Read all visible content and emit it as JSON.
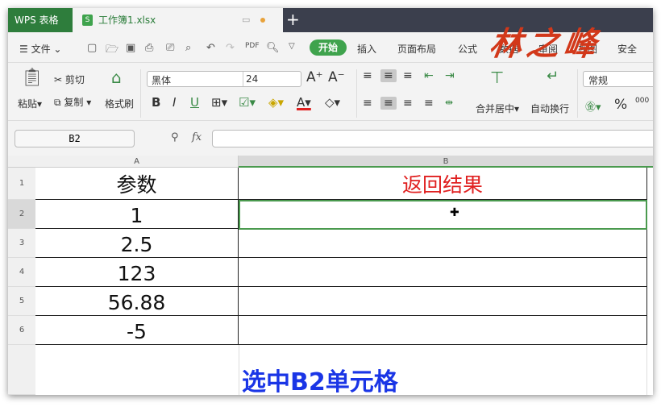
{
  "titlebar": {
    "app_tab": "WPS 表格",
    "doc_tab": "工作簿1.xlsx",
    "doc_icon": "S",
    "new_tab": "+"
  },
  "menu": {
    "file": "文件",
    "start": "开始",
    "tabs": [
      "插入",
      "页面布局",
      "公式",
      "数据",
      "审阅",
      "视图",
      "安全"
    ]
  },
  "watermark": "林之峰",
  "ribbon": {
    "paste": "粘贴",
    "cut": "剪切",
    "copy": "复制",
    "format_painter": "格式刷",
    "font": "黑体",
    "font_size": "24",
    "merge": "合并居中",
    "wrap": "自动换行",
    "number_format": "常规"
  },
  "formula_bar": {
    "name_box": "B2",
    "fx": "fx",
    "value": ""
  },
  "sheet": {
    "columns": [
      "A",
      "B"
    ],
    "rows": [
      {
        "num": "1",
        "a": "参数",
        "b": "返回结果"
      },
      {
        "num": "2",
        "a": "1",
        "b": ""
      },
      {
        "num": "3",
        "a": "2.5",
        "b": ""
      },
      {
        "num": "4",
        "a": "123",
        "b": ""
      },
      {
        "num": "5",
        "a": "56.88",
        "b": ""
      },
      {
        "num": "6",
        "a": "-5",
        "b": ""
      }
    ],
    "selected_cell": "B2",
    "header_b_color": "#e02020"
  },
  "caption": "选中B2单元格"
}
